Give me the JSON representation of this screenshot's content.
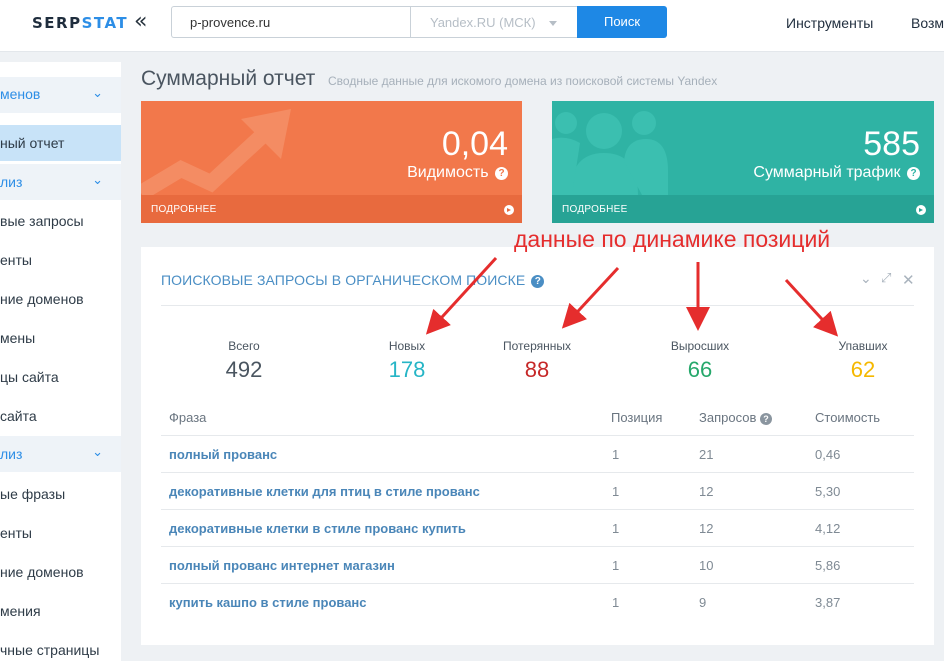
{
  "header": {
    "logo": {
      "part1": "SERP",
      "part2": "STAT"
    },
    "collapse_glyph": "«",
    "domain_value": "p-provence.ru",
    "engine": "Yandex.RU (МСК)",
    "search_label": "Поиск",
    "nav": [
      "Инструменты",
      "Возм"
    ]
  },
  "sidebar": {
    "items": [
      {
        "label": "менов",
        "type": "section"
      },
      {
        "label": "ный отчет",
        "type": "active"
      },
      {
        "label": "лиз",
        "type": "section"
      },
      {
        "label": "вые запросы",
        "type": "item"
      },
      {
        "label": "енты",
        "type": "item"
      },
      {
        "label": "ние доменов",
        "type": "item"
      },
      {
        "label": "мены",
        "type": "item"
      },
      {
        "label": "цы сайта",
        "type": "item"
      },
      {
        "label": "сайта",
        "type": "item"
      },
      {
        "label": "лиз",
        "type": "section"
      },
      {
        "label": "ые фразы",
        "type": "item"
      },
      {
        "label": "енты",
        "type": "item"
      },
      {
        "label": "ние доменов",
        "type": "item"
      },
      {
        "label": "мения",
        "type": "item"
      },
      {
        "label": "чные страницы",
        "type": "item"
      }
    ]
  },
  "page": {
    "title": "Суммарный отчет",
    "subtitle": "Сводные данные для искомого домена из поисковой системы Yandex"
  },
  "cards": [
    {
      "value": "0,04",
      "label": "Видимость",
      "footer": "ПОДРОБНЕЕ",
      "color": "#f2784b"
    },
    {
      "value": "585",
      "label": "Суммарный трафик",
      "footer": "ПОДРОБНЕЕ",
      "color": "#2fb3a4"
    }
  ],
  "panel": {
    "title": "ПОИСКОВЫЕ ЗАПРОСЫ В ОРГАНИЧЕСКОМ ПОИСКЕ",
    "stats": [
      {
        "label": "Всего",
        "value": "492",
        "color": "#4a5560"
      },
      {
        "label": "Новых",
        "value": "178",
        "color": "#26b5c6"
      },
      {
        "label": "Потерянных",
        "value": "88",
        "color": "#c62828"
      },
      {
        "label": "Выросших",
        "value": "66",
        "color": "#26a86b"
      },
      {
        "label": "Упавших",
        "value": "62",
        "color": "#f5b800"
      }
    ],
    "columns": [
      "Фраза",
      "Позиция",
      "Запросов",
      "Стоимость"
    ],
    "rows": [
      {
        "phrase": "полный прованс",
        "position": "1",
        "requests": "21",
        "cost": "0,46"
      },
      {
        "phrase": "декоративные клетки для птиц в стиле прованс",
        "position": "1",
        "requests": "12",
        "cost": "5,30"
      },
      {
        "phrase": "декоративные клетки в стиле прованс купить",
        "position": "1",
        "requests": "12",
        "cost": "4,12"
      },
      {
        "phrase": "полный прованс интернет магазин",
        "position": "1",
        "requests": "10",
        "cost": "5,86"
      },
      {
        "phrase": "купить кашпо в стиле прованс",
        "position": "1",
        "requests": "9",
        "cost": "3,87"
      }
    ]
  },
  "annotation": {
    "text": "данные по динамике позиций",
    "color": "#e52d2d"
  }
}
